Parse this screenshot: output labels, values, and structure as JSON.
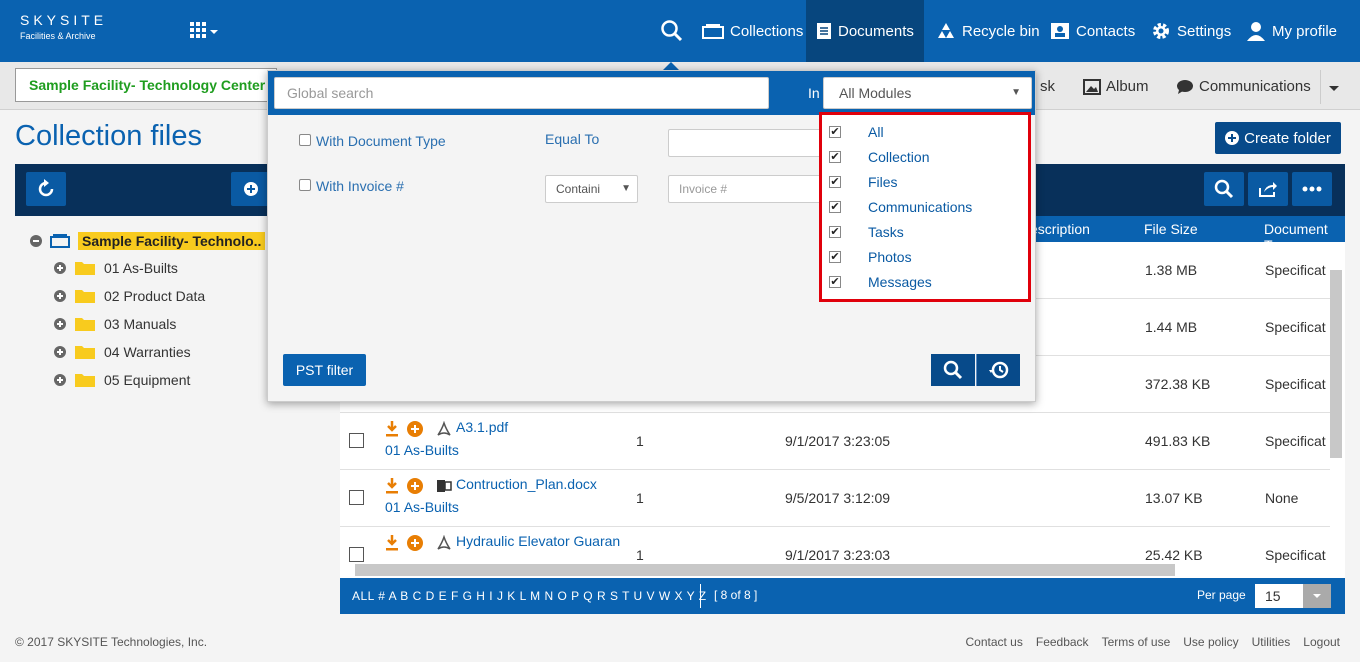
{
  "brand": {
    "line1": "SKYSITE",
    "line2": "Facilities & Archive"
  },
  "nav": {
    "collections": "Collections",
    "documents": "Documents",
    "recycle_bin": "Recycle bin",
    "contacts": "Contacts",
    "settings": "Settings",
    "my_profile": "My profile"
  },
  "subnav": {
    "facility": "Sample Facility- Technology Center",
    "task_partial": "sk",
    "album": "Album",
    "communications": "Communications"
  },
  "page": {
    "title": "Collection files",
    "create_folder": "Create folder"
  },
  "tree": {
    "root": "Sample Facility- Technolo..",
    "folders": [
      "01 As-Builts",
      "02 Product Data",
      "03 Manuals",
      "04 Warranties",
      "05 Equipment"
    ]
  },
  "table": {
    "headers": {
      "description": "escription",
      "file_size": "File Size",
      "doc_type": "Document Ty"
    },
    "rows": [
      {
        "name": "",
        "folder": "",
        "rev": "",
        "date": "",
        "size": "1.38 MB",
        "type": "Specificat"
      },
      {
        "name": "",
        "folder": "",
        "rev": "",
        "date": "",
        "size": "1.44 MB",
        "type": "Specificat"
      },
      {
        "name": "",
        "folder": "",
        "rev": "",
        "date": "",
        "size": "372.38 KB",
        "type": "Specificat"
      },
      {
        "name": "A3.1.pdf",
        "folder": "01 As-Builts",
        "rev": "1",
        "date": "9/1/2017 3:23:05",
        "size": "491.83 KB",
        "type": "Specificat"
      },
      {
        "name": "Contruction_Plan.docx",
        "folder": "01 As-Builts",
        "rev": "1",
        "date": "9/5/2017 3:12:09",
        "size": "13.07 KB",
        "type": "None"
      },
      {
        "name": "Hydraulic Elevator Guaran",
        "folder": "",
        "rev": "1",
        "date": "9/1/2017 3:23:03",
        "size": "25.42 KB",
        "type": "Specificat"
      }
    ]
  },
  "pager": {
    "alpha": "ALL # A B C D E F G H I J K L M N O P Q R S T U V W X Y Z",
    "count": "[ 8 of 8 ]",
    "per_page_label": "Per page",
    "per_page_value": "15"
  },
  "footer": {
    "copyright": "© 2017 SKYSITE Technologies, Inc.",
    "links": [
      "Contact us",
      "Feedback",
      "Terms of use",
      "Use policy",
      "Utilities",
      "Logout"
    ]
  },
  "search_panel": {
    "placeholder": "Global search",
    "in_label": "In",
    "module_selected": "All Modules",
    "with_doc_type": "With Document Type",
    "equal_to": "Equal To",
    "with_invoice": "With Invoice #",
    "containing": "Containi",
    "invoice_placeholder": "Invoice #",
    "pst_filter": "PST filter",
    "modules": [
      "All",
      "Collection",
      "Files",
      "Communications",
      "Tasks",
      "Photos",
      "Messages"
    ]
  },
  "colors": {
    "primary": "#0a62b0",
    "dark": "#07467e",
    "highlight": "#e0000b",
    "folder": "#f8cb1e",
    "accent_orange": "#e87e04"
  }
}
